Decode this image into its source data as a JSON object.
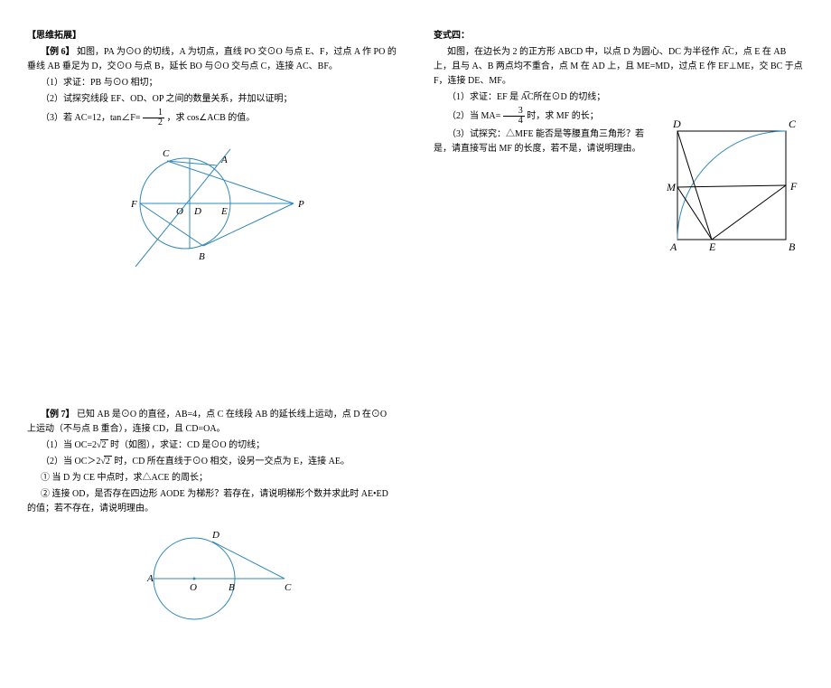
{
  "left": {
    "section_title": "【思维拓展】",
    "ex6": {
      "title": "【例 6】",
      "intro": "如图，PA 为⊙O 的切线，A 为切点，直线 PO 交⊙O 与点 E、F，过点 A 作 PO 的垂线 AB 垂足为 D，交⊙O 与点 B，延长 BO 与⊙O 交与点 C，连接 AC、BF。",
      "q1": "（1）求证：PB 与⊙O 相切；",
      "q2": "（2）试探究线段 EF、OD、OP 之间的数量关系，并加以证明；",
      "q3_a": "（3）若 AC=12，tan∠F=",
      "q3_b": "，求 cos∠ACB 的值。",
      "frac_num": "1",
      "frac_den": "2",
      "labels": {
        "C": "C",
        "A": "A",
        "F": "F",
        "O": "O",
        "D": "D",
        "E": "E",
        "P": "P",
        "B": "B"
      }
    },
    "ex7": {
      "title": "【例 7】",
      "intro": "已知 AB 是⊙O 的直径，AB=4，点 C 在线段 AB 的延长线上运动，点 D 在⊙O 上运动（不与点 B 重合），连接 CD，且 CD=OA。",
      "q1_a": "（1）当 OC=2",
      "q1_b": "时（如图），求证：CD 是⊙O 的切线；",
      "sqrt2": "2",
      "q2_a": "（2）当 OC＞2",
      "q2_b": "时，CD 所在直线于⊙O 相交，设另一交点为 E，连接 AE。",
      "q3": "① 当 D 为 CE 中点时，求△ACE 的周长；",
      "q4": "② 连接 OD，是否存在四边形 AODE 为梯形？若存在，请说明梯形个数并求此时 AE•ED 的值；若不存在，请说明理由。",
      "labels": {
        "A": "A",
        "O": "O",
        "B": "B",
        "C": "C",
        "D": "D"
      }
    }
  },
  "right": {
    "title": "变式四：",
    "intro": "如图，在边长为 2 的正方形 ABCD 中，以点 D 为圆心、DC 为半径作 A͡C，点 E 在 AB 上，且与 A、B 两点均不重合，点 M 在 AD 上，且 ME=MD，过点 E 作 EF⊥ME，交 BC 于点 F，连接 DE、MF。",
    "q1": "（1）求证：EF 是 A͡C所在⊙D 的切线；",
    "q2_a": "（2）当 MA=",
    "q2_b": " 时，求 MF 的长；",
    "frac_num": "3",
    "frac_den": "4",
    "q3": "（3）试探究：△MFE 能否是等腰直角三角形？若是，请直接写出 MF 的长度，若不是，请说明理由。",
    "labels": {
      "D": "D",
      "C": "C",
      "M": "M",
      "F": "F",
      "A": "A",
      "E": "E",
      "B": "B"
    }
  }
}
